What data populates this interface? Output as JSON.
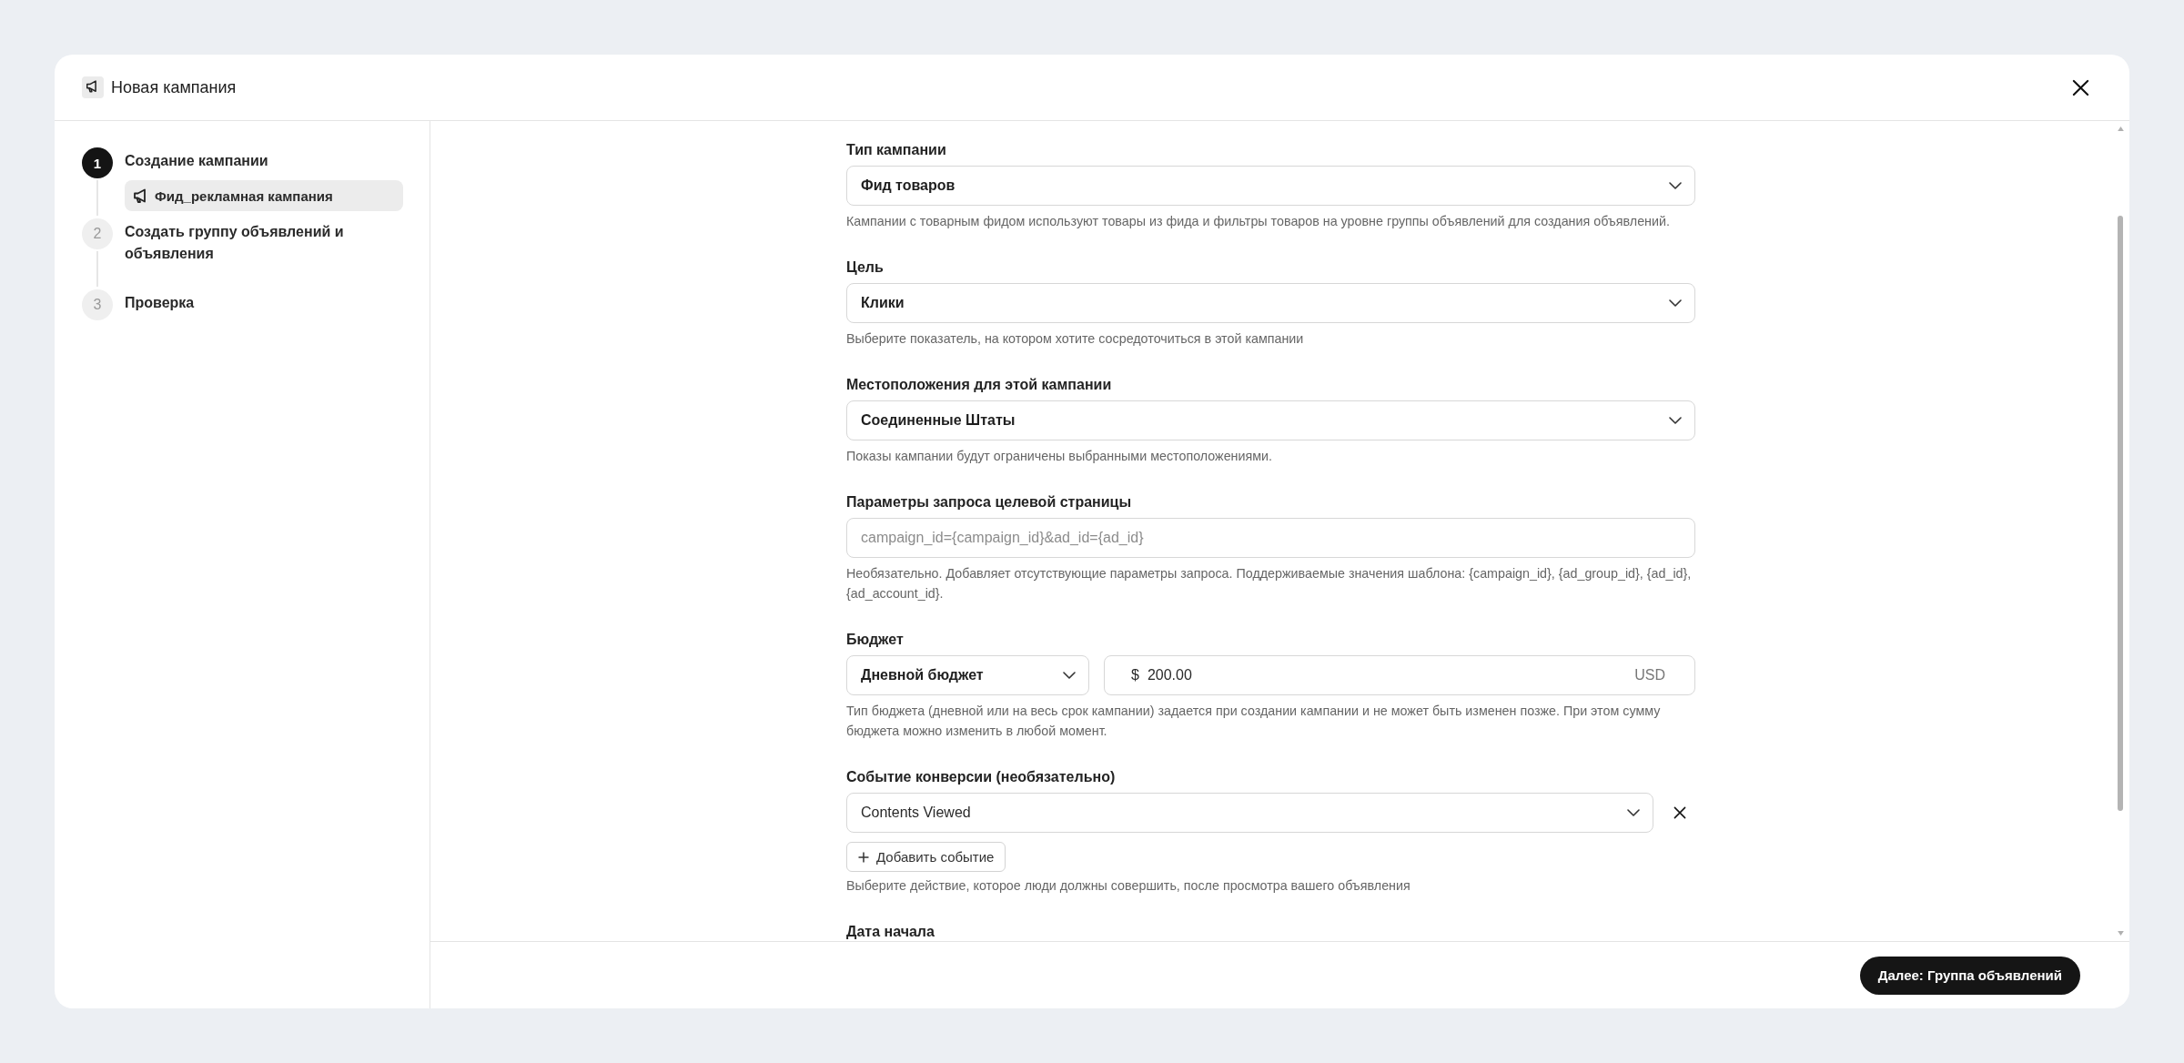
{
  "window": {
    "title": "Новая кампания"
  },
  "steps": [
    {
      "number": "1",
      "label": "Создание кампании",
      "selected": true,
      "items": [
        {
          "label": "Фид_рекламная кампания",
          "selected": true
        }
      ]
    },
    {
      "number": "2",
      "label": "Создать группу объявлений и объявления",
      "selected": false
    },
    {
      "number": "3",
      "label": "Проверка",
      "selected": false
    }
  ],
  "form": {
    "fields": [
      {
        "kind": "select",
        "label": "Тип кампании",
        "value": "Фид товаров",
        "help": "Кампании с товарным фидом используют товары из фида и фильтры товаров на уровне группы объявлений для создания объявлений."
      },
      {
        "kind": "select",
        "label": "Цель",
        "value": "Клики",
        "help": "Выберите показатель, на котором хотите сосредоточиться в этой кампании"
      },
      {
        "kind": "select",
        "label": "Местоположения для этой кампании",
        "value": "Соединенные Штаты",
        "help": "Показы кампании будут ограничены выбранными местоположениями."
      },
      {
        "kind": "text",
        "label": "Параметры запроса целевой страницы",
        "placeholder": "campaign_id={campaign_id}&ad_id={ad_id}",
        "help": "Необязательно. Добавляет отсутствующие параметры запроса. Поддерживаемые значения шаблона: {campaign_id}, {ad_group_id}, {ad_id}, {ad_account_id}."
      },
      {
        "kind": "budget",
        "label": "Бюджет",
        "budget_type": "Дневной бюджет",
        "currency_symbol": "$",
        "amount": "200.00",
        "currency": "USD",
        "help": "Тип бюджета (дневной или на весь срок кампании) задается при создании кампании и не может быть изменен позже. При этом сумму бюджета можно изменить в любой момент."
      },
      {
        "kind": "events",
        "label": "Событие конверсии (необязательно)",
        "events": [
          {
            "value": "Contents Viewed"
          }
        ],
        "add_button": "Добавить событие",
        "help": "Выберите действие, которое люди должны совершить, после просмотра вашего объявления"
      },
      {
        "kind": "date",
        "label": "Дата начала"
      }
    ]
  },
  "footer": {
    "next_button": "Далее: Группа объявлений"
  }
}
